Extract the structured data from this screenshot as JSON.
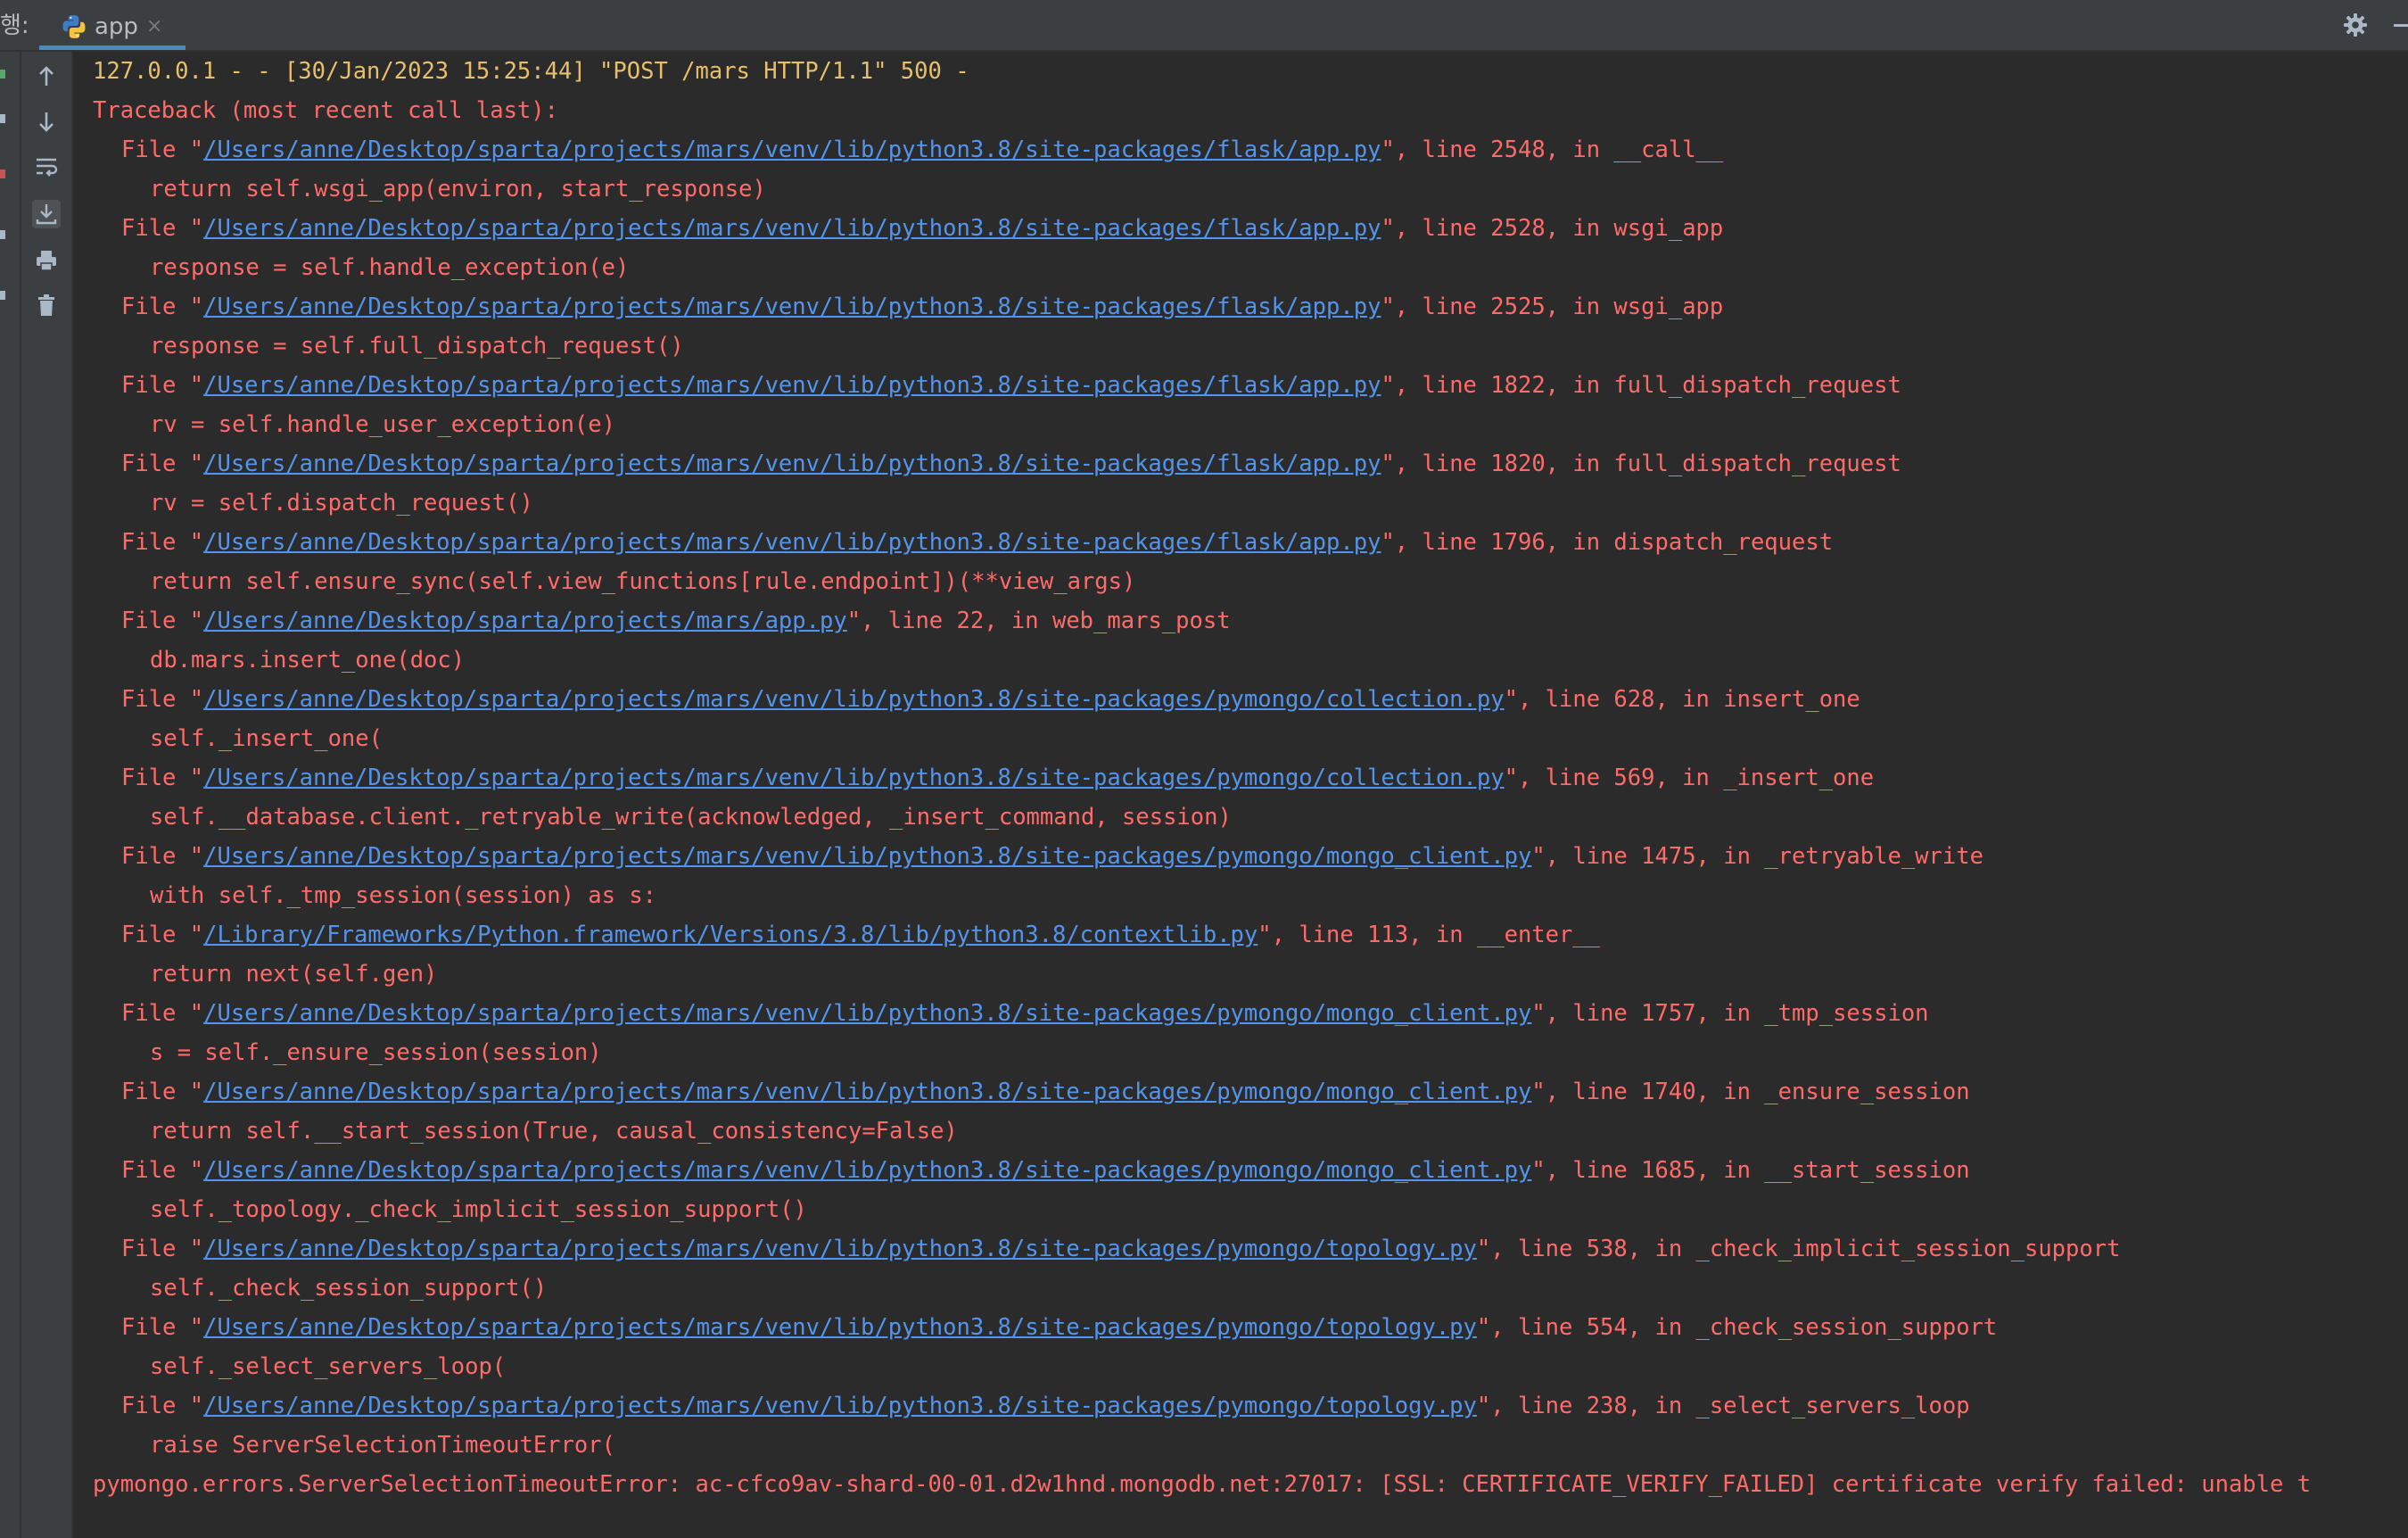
{
  "run_tool": {
    "label": "행:",
    "tab": {
      "label": "app",
      "close": "×"
    }
  },
  "console": {
    "request_line": "127.0.0.1 - - [30/Jan/2023 15:25:44] \"POST /mars HTTP/1.1\" 500 -",
    "traceback_header": "Traceback (most recent call last):",
    "frames": [
      {
        "path": "/Users/anne/Desktop/sparta/projects/mars/venv/lib/python3.8/site-packages/flask/app.py",
        "suffix": "\", line 2548, in __call__",
        "code": "return self.wsgi_app(environ, start_response)"
      },
      {
        "path": "/Users/anne/Desktop/sparta/projects/mars/venv/lib/python3.8/site-packages/flask/app.py",
        "suffix": "\", line 2528, in wsgi_app",
        "code": "response = self.handle_exception(e)"
      },
      {
        "path": "/Users/anne/Desktop/sparta/projects/mars/venv/lib/python3.8/site-packages/flask/app.py",
        "suffix": "\", line 2525, in wsgi_app",
        "code": "response = self.full_dispatch_request()"
      },
      {
        "path": "/Users/anne/Desktop/sparta/projects/mars/venv/lib/python3.8/site-packages/flask/app.py",
        "suffix": "\", line 1822, in full_dispatch_request",
        "code": "rv = self.handle_user_exception(e)"
      },
      {
        "path": "/Users/anne/Desktop/sparta/projects/mars/venv/lib/python3.8/site-packages/flask/app.py",
        "suffix": "\", line 1820, in full_dispatch_request",
        "code": "rv = self.dispatch_request()"
      },
      {
        "path": "/Users/anne/Desktop/sparta/projects/mars/venv/lib/python3.8/site-packages/flask/app.py",
        "suffix": "\", line 1796, in dispatch_request",
        "code": "return self.ensure_sync(self.view_functions[rule.endpoint])(**view_args)"
      },
      {
        "path": "/Users/anne/Desktop/sparta/projects/mars/app.py",
        "suffix": "\", line 22, in web_mars_post",
        "code": "db.mars.insert_one(doc)"
      },
      {
        "path": "/Users/anne/Desktop/sparta/projects/mars/venv/lib/python3.8/site-packages/pymongo/collection.py",
        "suffix": "\", line 628, in insert_one",
        "code": "self._insert_one("
      },
      {
        "path": "/Users/anne/Desktop/sparta/projects/mars/venv/lib/python3.8/site-packages/pymongo/collection.py",
        "suffix": "\", line 569, in _insert_one",
        "code": "self.__database.client._retryable_write(acknowledged, _insert_command, session)"
      },
      {
        "path": "/Users/anne/Desktop/sparta/projects/mars/venv/lib/python3.8/site-packages/pymongo/mongo_client.py",
        "suffix": "\", line 1475, in _retryable_write",
        "code": "with self._tmp_session(session) as s:"
      },
      {
        "path": "/Library/Frameworks/Python.framework/Versions/3.8/lib/python3.8/contextlib.py",
        "suffix": "\", line 113, in __enter__",
        "code": "return next(self.gen)"
      },
      {
        "path": "/Users/anne/Desktop/sparta/projects/mars/venv/lib/python3.8/site-packages/pymongo/mongo_client.py",
        "suffix": "\", line 1757, in _tmp_session",
        "code": "s = self._ensure_session(session)"
      },
      {
        "path": "/Users/anne/Desktop/sparta/projects/mars/venv/lib/python3.8/site-packages/pymongo/mongo_client.py",
        "suffix": "\", line 1740, in _ensure_session",
        "code": "return self.__start_session(True, causal_consistency=False)"
      },
      {
        "path": "/Users/anne/Desktop/sparta/projects/mars/venv/lib/python3.8/site-packages/pymongo/mongo_client.py",
        "suffix": "\", line 1685, in __start_session",
        "code": "self._topology._check_implicit_session_support()"
      },
      {
        "path": "/Users/anne/Desktop/sparta/projects/mars/venv/lib/python3.8/site-packages/pymongo/topology.py",
        "suffix": "\", line 538, in _check_implicit_session_support",
        "code": "self._check_session_support()"
      },
      {
        "path": "/Users/anne/Desktop/sparta/projects/mars/venv/lib/python3.8/site-packages/pymongo/topology.py",
        "suffix": "\", line 554, in _check_session_support",
        "code": "self._select_servers_loop("
      },
      {
        "path": "/Users/anne/Desktop/sparta/projects/mars/venv/lib/python3.8/site-packages/pymongo/topology.py",
        "suffix": "\", line 238, in _select_servers_loop",
        "code": "raise ServerSelectionTimeoutError("
      }
    ],
    "error_line": "pymongo.errors.ServerSelectionTimeoutError: ac-cfco9av-shard-00-01.d2w1hnd.mongodb.net:27017: [SSL: CERTIFICATE_VERIFY_FAILED] certificate verify failed: unable t"
  },
  "icons": {
    "tab": "python-icon",
    "settings": "gear-icon",
    "hide": "minimize-icon",
    "toolbar": [
      "arrow-up-icon",
      "arrow-down-icon",
      "soft-wrap-icon",
      "scroll-to-end-icon",
      "print-icon",
      "trash-icon"
    ]
  },
  "colors": {
    "background": "#2b2b2b",
    "error_text": "#ff6b68",
    "request_text": "#e8bf6a",
    "link": "#5394ec",
    "tab_underline": "#4a88c7"
  }
}
